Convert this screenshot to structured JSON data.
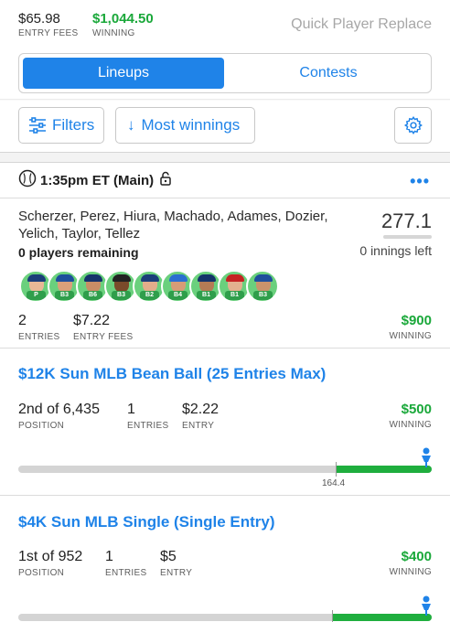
{
  "header": {
    "entry_fees_value": "$65.98",
    "entry_fees_label": "ENTRY FEES",
    "winning_value": "$1,044.50",
    "winning_label": "WINNING",
    "quick_replace": "Quick Player Replace"
  },
  "tabs": {
    "lineups": "Lineups",
    "contests": "Contests",
    "active": "Lineups"
  },
  "toolbar": {
    "filters": "Filters",
    "sort": "Most winnings",
    "sort_arrow": "↓"
  },
  "slate": {
    "title": "1:35pm ET (Main)",
    "players": "Scherzer, Perez, Hiura, Machado, Adames, Dozier, Yelich, Taylor, Tellez",
    "players_remaining": "0 players remaining",
    "points": "277.1",
    "innings_left": "0 innings left",
    "positions": [
      "P",
      "B3",
      "B6",
      "B3",
      "B2",
      "B4",
      "B1",
      "B1",
      "B3"
    ],
    "entries_value": "2",
    "entries_label": "ENTRIES",
    "entry_fees_value": "$7.22",
    "entry_fees_label": "ENTRY FEES",
    "winning_value": "$900",
    "winning_label": "WINNING"
  },
  "contests": [
    {
      "title": "$12K Sun MLB Bean Ball (25 Entries Max)",
      "position_value": "2nd of 6,435",
      "position_label": "POSITION",
      "entries_value": "1",
      "entries_label": "ENTRIES",
      "entry_value": "$2.22",
      "entry_label": "ENTRY",
      "winning_value": "$500",
      "winning_label": "WINNING",
      "progress_fraction": 0.23,
      "cutline_points": "164.4"
    },
    {
      "title": "$4K Sun MLB Single (Single Entry)",
      "position_value": "1st of 952",
      "position_label": "POSITION",
      "entries_value": "1",
      "entries_label": "ENTRIES",
      "entry_value": "$5",
      "entry_label": "ENTRY",
      "winning_value": "$400",
      "winning_label": "WINNING",
      "progress_fraction": 0.24
    }
  ],
  "colors": {
    "accent": "#1f83e8",
    "green": "#1aa83a",
    "avatar_bg": "#6ad07d"
  }
}
